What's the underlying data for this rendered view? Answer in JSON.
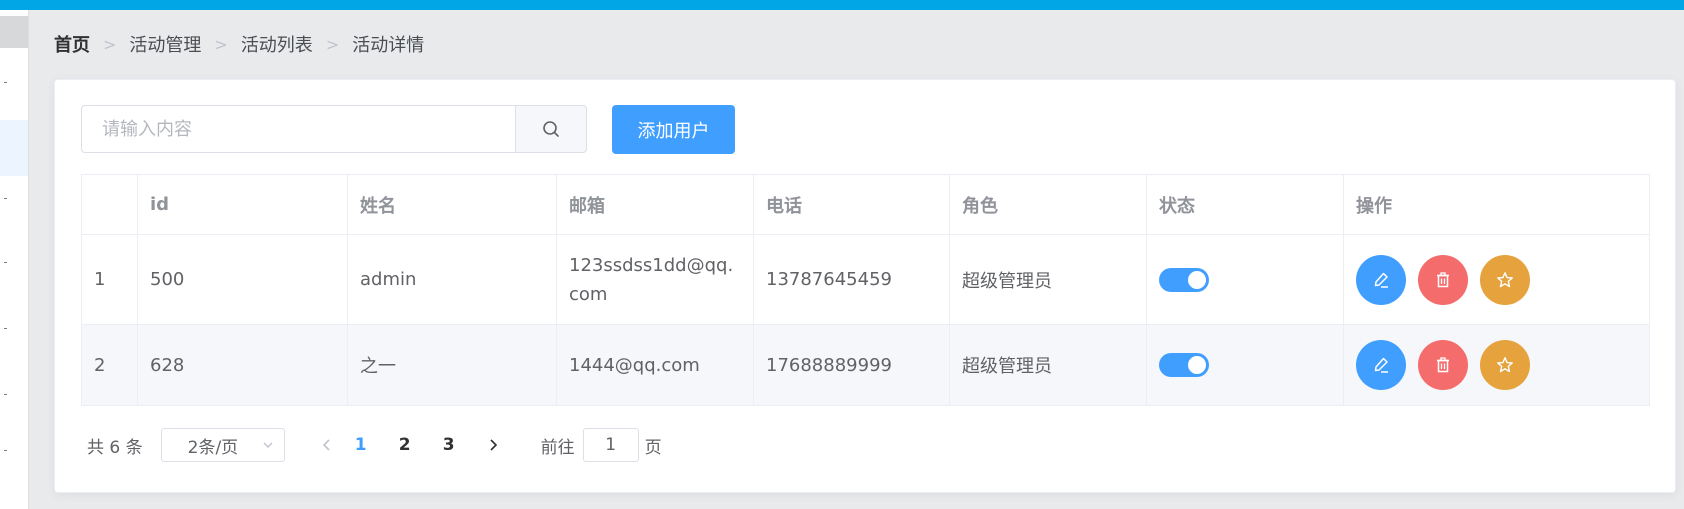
{
  "breadcrumb": {
    "home": "首页",
    "items": [
      "活动管理",
      "活动列表",
      "活动详情"
    ]
  },
  "search": {
    "placeholder": "请输入内容",
    "value": ""
  },
  "add_button": "添加用户",
  "table": {
    "columns": [
      "",
      "id",
      "姓名",
      "邮箱",
      "电话",
      "角色",
      "状态",
      "操作"
    ],
    "rows": [
      {
        "index": "1",
        "id": "500",
        "name": "admin",
        "email": "123ssdss1dd@qq.com",
        "phone": "13787645459",
        "role": "超级管理员",
        "status": true
      },
      {
        "index": "2",
        "id": "628",
        "name": "之一",
        "email": "1444@qq.com",
        "phone": "17688889999",
        "role": "超级管理员",
        "status": true
      }
    ]
  },
  "pagination": {
    "total_text": "共 6 条",
    "page_size": "2条/页",
    "pages": [
      "1",
      "2",
      "3"
    ],
    "current_page": "1",
    "goto_label": "前往",
    "goto_value": "1",
    "goto_suffix": "页"
  },
  "colors": {
    "topbar": "#00a6e6",
    "primary": "#409eff",
    "danger": "#f56c6c",
    "warning": "#e6a23c"
  },
  "icons": [
    "search-icon",
    "edit-icon",
    "delete-icon",
    "star-icon",
    "chevron-down-icon",
    "chevron-left-icon",
    "chevron-right-icon"
  ]
}
